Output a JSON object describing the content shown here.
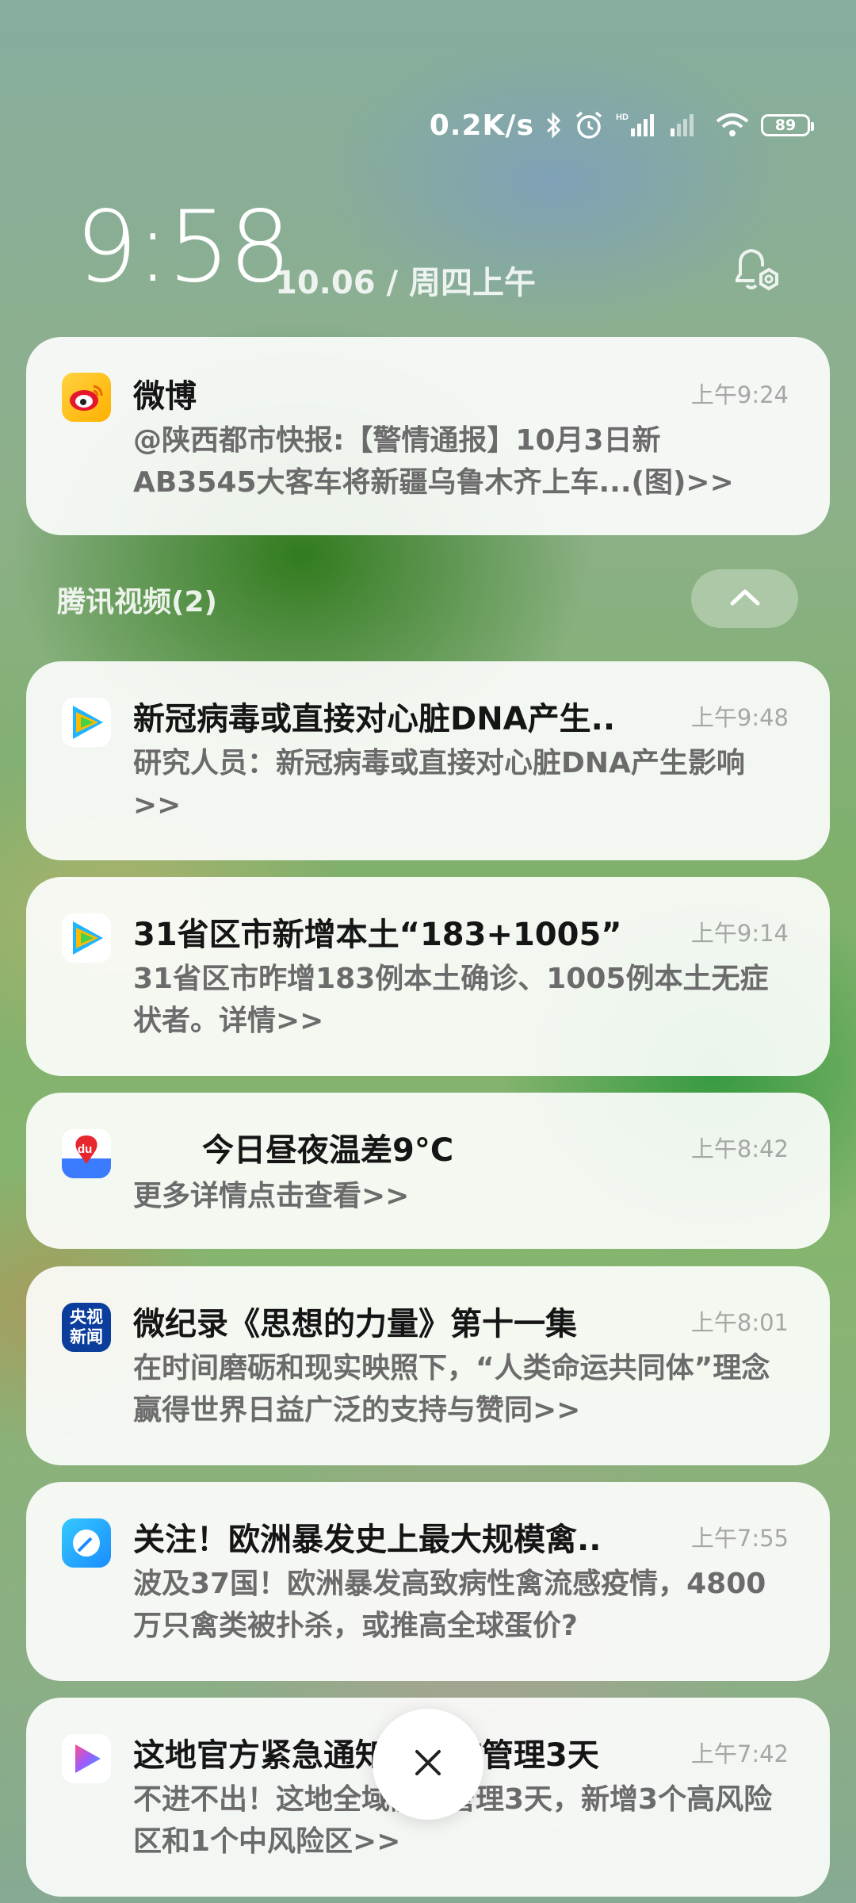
{
  "status_bar": {
    "net_speed": "0.2K/s",
    "battery_level": "89",
    "icons": [
      "bluetooth-icon",
      "alarm-icon",
      "signal-hd-icon",
      "signal-icon",
      "wifi-icon",
      "battery-icon"
    ]
  },
  "lockscreen": {
    "time": "9:58",
    "date": "10.06 / 周四上午",
    "settings_icon": "notification-settings-icon"
  },
  "group": {
    "title": "腾讯视频(2)"
  },
  "notifications": [
    {
      "app_icon": "weibo-icon",
      "title": "微博",
      "time": "上午9:24",
      "body": "@陕西都市快报:【警情通报】10月3日新AB3545大客车将新疆乌鲁木齐上车...(图)>>"
    },
    {
      "app_icon": "tencent-video-icon",
      "title": "新冠病毒或直接对心脏DNA产生..",
      "time": "上午9:48",
      "body": "研究人员：新冠病毒或直接对心脏DNA产生影响>>"
    },
    {
      "app_icon": "tencent-video-icon",
      "title": "31省区市新增本土“183+1005”",
      "time": "上午9:14",
      "body": "31省区市昨增183例本土确诊、1005例本土无症状者。详情>>"
    },
    {
      "app_icon": "baidu-icon",
      "app_icon_label": "du",
      "title": "今日昼夜温差9°C",
      "time": "上午8:42",
      "body": "更多详情点击查看>>"
    },
    {
      "app_icon": "cctv-news-icon",
      "app_icon_label": "央视新闻",
      "title": "微纪录《思想的力量》第十一集",
      "time": "上午8:01",
      "body": "在时间磨砺和现实映照下，“人类命运共同体”理念赢得世界日益广泛的支持与赞同>>"
    },
    {
      "app_icon": "browser-icon",
      "title": "关注！欧洲暴发史上最大规模禽..",
      "time": "上午7:55",
      "body": "波及37国！欧洲暴发高致病性禽流感疫情，4800万只禽类被扑杀，或推高全球蛋价?"
    },
    {
      "app_icon": "video-play-icon",
      "title": "这地官方紧急通知：静态管理3天",
      "time": "上午7:42",
      "body": "不进不出！这地全域静态管理3天，新增3个高风险区和1个中风险区>>"
    }
  ],
  "close_button": {
    "icon": "close-icon"
  },
  "colors": {
    "card_bg": "#ffffff",
    "title": "#151515",
    "time": "#a6a6a6",
    "body": "#6b6b6b"
  }
}
